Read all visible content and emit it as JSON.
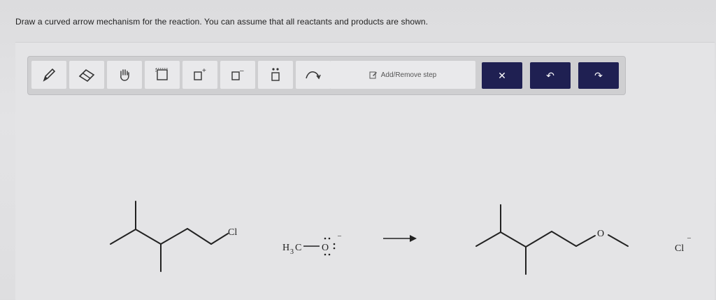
{
  "question": {
    "text": "Draw a curved arrow mechanism for the reaction. You can assume that all reactants and products are shown."
  },
  "toolbar": {
    "tools": [
      {
        "name": "pencil-icon"
      },
      {
        "name": "eraser-icon"
      },
      {
        "name": "hand-icon"
      },
      {
        "name": "select-box-icon"
      },
      {
        "name": "positive-charge-icon",
        "label": "+"
      },
      {
        "name": "negative-charge-icon",
        "label": "–"
      },
      {
        "name": "lone-pair-icon"
      },
      {
        "name": "curved-arrow-icon"
      }
    ],
    "add_remove_step_label": "Add/Remove step",
    "clear_label": "✕",
    "undo_label": "↶",
    "redo_label": "↷"
  },
  "reaction": {
    "reactant1_leaving": "Cl",
    "reactant2": {
      "h": "H",
      "sub": "3",
      "c": "C",
      "o": "O",
      "charge": "–"
    },
    "product1_o": "O",
    "product2": {
      "text": "Cl",
      "charge": "–"
    }
  }
}
